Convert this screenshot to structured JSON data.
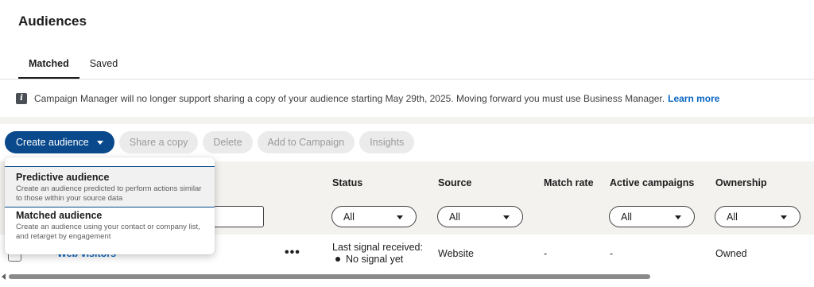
{
  "page": {
    "title": "Audiences"
  },
  "tabs": [
    {
      "label": "Matched",
      "active": true
    },
    {
      "label": "Saved",
      "active": false
    }
  ],
  "notice": {
    "icon": "info-icon",
    "text": "Campaign Manager will no longer support sharing a copy of your audience starting May 29th, 2025. Moving forward you must use Business Manager.",
    "link": "Learn more"
  },
  "toolbar": {
    "create_label": "Create audience",
    "share_label": "Share a copy",
    "delete_label": "Delete",
    "add_campaign_label": "Add to Campaign",
    "insights_label": "Insights"
  },
  "dropdown": {
    "items": [
      {
        "title": "Predictive audience",
        "description": "Create an audience predicted to perform actions similar to those within your source data"
      },
      {
        "title": "Matched audience",
        "description": "Create an audience using your contact or company list, and retarget by engagement"
      }
    ]
  },
  "table": {
    "columns": {
      "status": "Status",
      "source": "Source",
      "match_rate": "Match rate",
      "active_campaigns": "Active campaigns",
      "ownership": "Ownership"
    },
    "filters": {
      "status": "All",
      "source": "All",
      "active_campaigns": "All",
      "ownership": "All"
    },
    "rows": [
      {
        "name": "Web visitors",
        "more": "•••",
        "status_line1": "Last signal received:",
        "status_line2": "No signal yet",
        "source": "Website",
        "match_rate": "-",
        "active_campaigns": "-",
        "ownership": "Owned"
      }
    ]
  },
  "colors": {
    "primary": "#0a4a8c",
    "link": "#0a66c2",
    "band": "#f3f2ef"
  }
}
